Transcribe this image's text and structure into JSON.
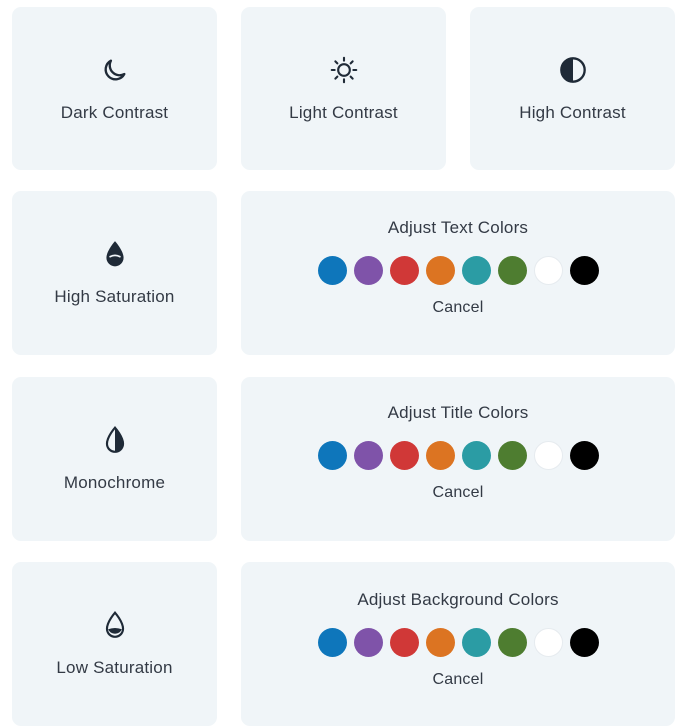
{
  "tiles": {
    "dark_contrast": {
      "label": "Dark Contrast",
      "icon": "moon-icon"
    },
    "light_contrast": {
      "label": "Light Contrast",
      "icon": "sun-icon"
    },
    "high_contrast": {
      "label": "High Contrast",
      "icon": "half-circle-icon"
    },
    "high_saturation": {
      "label": "High Saturation",
      "icon": "filled-drop-icon"
    },
    "monochrome": {
      "label": "Monochrome",
      "icon": "half-drop-icon"
    },
    "low_saturation": {
      "label": "Low Saturation",
      "icon": "low-drop-icon"
    }
  },
  "color_panels": {
    "text": {
      "title": "Adjust Text Colors",
      "cancel_label": "Cancel"
    },
    "title": {
      "title": "Adjust Title Colors",
      "cancel_label": "Cancel"
    },
    "background": {
      "title": "Adjust Background Colors",
      "cancel_label": "Cancel"
    }
  },
  "swatch_colors": {
    "blue": "#0e76bb",
    "purple": "#7f53a9",
    "red": "#d03837",
    "orange": "#dc7422",
    "teal": "#2b9ca4",
    "green": "#4e7d30",
    "white": "#ffffff",
    "black": "#000000"
  }
}
